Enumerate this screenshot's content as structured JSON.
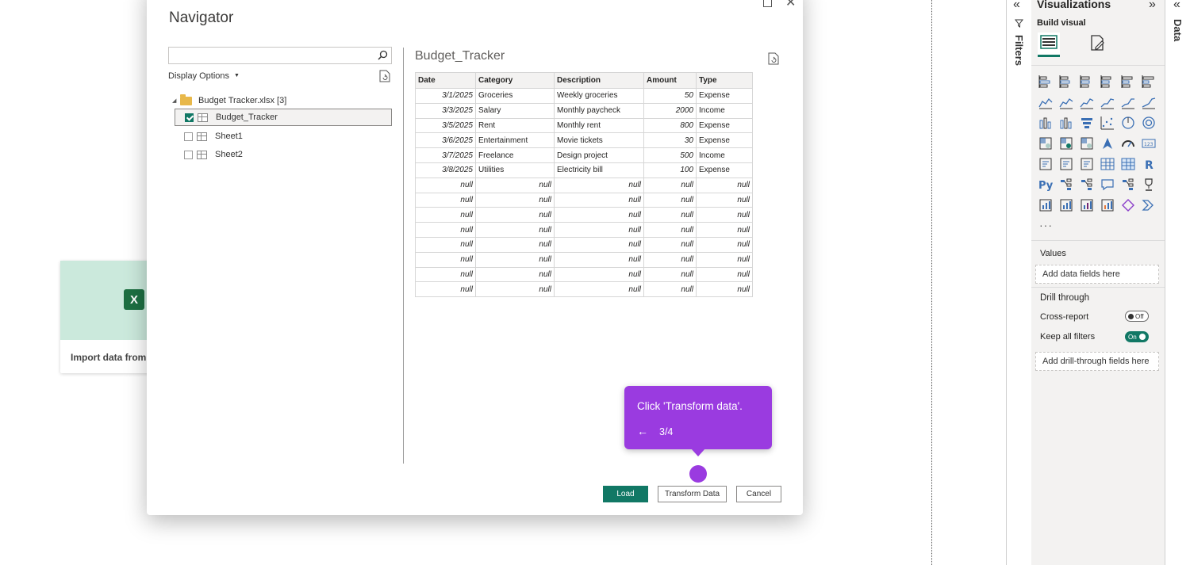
{
  "background_card": {
    "icon_letter": "X",
    "label": "Import data from"
  },
  "filters_pane": {
    "label": "Filters"
  },
  "data_pane": {
    "label": "Data"
  },
  "visualizations": {
    "title": "Visualizations",
    "build_visual_label": "Build visual",
    "tabs": [
      "build-visual-icon",
      "format-visual-icon"
    ],
    "more": "···",
    "values_label": "Values",
    "values_placeholder": "Add data fields here",
    "drill_through_label": "Drill through",
    "cross_report_label": "Cross-report",
    "cross_report_toggle": "Off",
    "keep_all_filters_label": "Keep all filters",
    "keep_all_filters_toggle": "On",
    "drill_placeholder": "Add drill-through fields here",
    "icons": [
      "stacked-bar-chart-icon",
      "stacked-column-chart-icon",
      "clustered-bar-chart-icon",
      "clustered-column-chart-icon",
      "100-stacked-bar-chart-icon",
      "100-stacked-column-chart-icon",
      "line-chart-icon",
      "area-chart-icon",
      "stacked-area-chart-icon",
      "100-stacked-area-chart-icon",
      "line-stacked-column-chart-icon",
      "line-clustered-column-chart-icon",
      "ribbon-chart-icon",
      "waterfall-chart-icon",
      "funnel-chart-icon",
      "scatter-chart-icon",
      "pie-chart-icon",
      "donut-chart-icon",
      "treemap-icon",
      "map-icon",
      "filled-map-icon",
      "azure-map-icon",
      "gauge-icon",
      "card-icon",
      "multi-row-card-icon",
      "kpi-icon",
      "slicer-icon",
      "table-icon",
      "matrix-icon",
      "r-visual-icon",
      "python-visual-icon",
      "key-influencers-icon",
      "decomposition-tree-icon",
      "qa-icon",
      "smart-narrative-icon",
      "metrics-icon",
      "paginated-report-icon",
      "arcgis-map-icon",
      "power-apps-icon",
      "power-automate-icon",
      "diamond-visual-icon",
      "chevron-visual-icon"
    ]
  },
  "navigator": {
    "title": "Navigator",
    "search_value": "",
    "display_options": "Display Options",
    "tree": {
      "file": "Budget Tracker.xlsx [3]",
      "items": [
        {
          "label": "Budget_Tracker",
          "checked": true
        },
        {
          "label": "Sheet1",
          "checked": false
        },
        {
          "label": "Sheet2",
          "checked": false
        }
      ]
    },
    "preview": {
      "title": "Budget_Tracker",
      "columns": [
        "Date",
        "Category",
        "Description",
        "Amount",
        "Type"
      ],
      "rows": [
        [
          "3/1/2025",
          "Groceries",
          "Weekly groceries",
          "50",
          "Expense"
        ],
        [
          "3/3/2025",
          "Salary",
          "Monthly paycheck",
          "2000",
          "Income"
        ],
        [
          "3/5/2025",
          "Rent",
          "Monthly rent",
          "800",
          "Expense"
        ],
        [
          "3/6/2025",
          "Entertainment",
          "Movie tickets",
          "30",
          "Expense"
        ],
        [
          "3/7/2025",
          "Freelance",
          "Design project",
          "500",
          "Income"
        ],
        [
          "3/8/2025",
          "Utilities",
          "Electricity bill",
          "100",
          "Expense"
        ],
        [
          "null",
          "null",
          "null",
          "null",
          "null"
        ],
        [
          "null",
          "null",
          "null",
          "null",
          "null"
        ],
        [
          "null",
          "null",
          "null",
          "null",
          "null"
        ],
        [
          "null",
          "null",
          "null",
          "null",
          "null"
        ],
        [
          "null",
          "null",
          "null",
          "null",
          "null"
        ],
        [
          "null",
          "null",
          "null",
          "null",
          "null"
        ],
        [
          "null",
          "null",
          "null",
          "null",
          "null"
        ],
        [
          "null",
          "null",
          "null",
          "null",
          "null"
        ]
      ]
    },
    "buttons": {
      "load": "Load",
      "transform": "Transform Data",
      "cancel": "Cancel"
    }
  },
  "tooltip": {
    "message": "Click 'Transform data'.",
    "back": "←",
    "step": "3/4"
  },
  "colors": {
    "accent": "#117865",
    "tooltip": "#9a3be0",
    "excel": "#1d6f42"
  }
}
